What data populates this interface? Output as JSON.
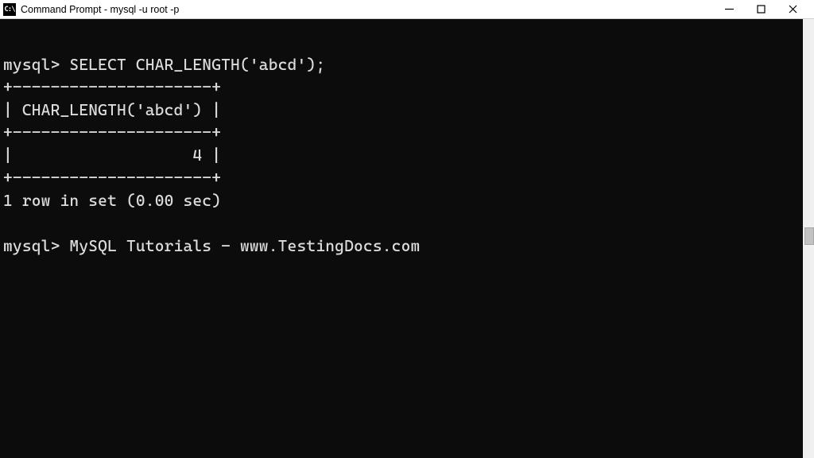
{
  "titlebar": {
    "icon_label": "C:\\",
    "title": "Command Prompt - mysql  -u root -p"
  },
  "terminal": {
    "lines": [
      "mysql> SELECT CHAR_LENGTH('abcd');",
      "+---------------------+",
      "| CHAR_LENGTH('abcd') |",
      "+---------------------+",
      "|                   4 |",
      "+---------------------+",
      "1 row in set (0.00 sec)",
      "",
      "mysql> MySQL Tutorials - www.TestingDocs.com"
    ]
  }
}
